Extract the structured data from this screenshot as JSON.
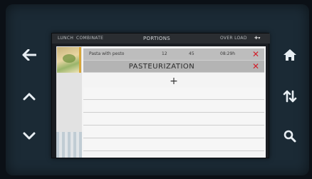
{
  "nav": {
    "back_icon": "arrow-left-icon",
    "up_icon": "chevron-up-icon",
    "down_icon": "chevron-down-icon",
    "home_icon": "home-icon",
    "sort_icon": "sort-arrows-icon",
    "search_icon": "search-icon"
  },
  "topbar": {
    "left_label_a": "LUNCH",
    "left_label_b": "COMBINATE",
    "title": "PORTIONS",
    "right_label": "OVER LOAD"
  },
  "program": {
    "recipe_row": {
      "name": "Pasta with pesto",
      "value_1": "12",
      "value_2": "45",
      "value_3": "08:29h"
    },
    "pasteurization_label": "PASTEURIZATION",
    "add_symbol": "+",
    "delete_symbol": "✕"
  },
  "colors": {
    "delete_red": "#d21e2a",
    "bezel": "#1b2a35",
    "thumb_accent": "#d7a63a"
  }
}
